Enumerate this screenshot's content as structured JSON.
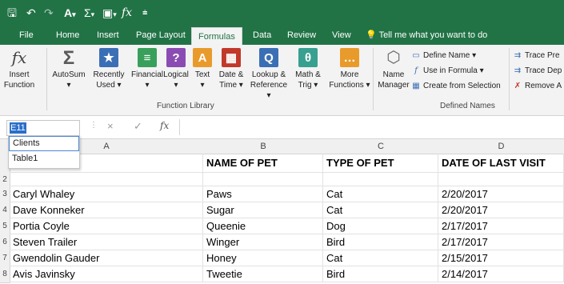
{
  "qat": {
    "icons": [
      "save-icon",
      "undo-icon",
      "redo-icon",
      "font-color-icon",
      "autosum-icon",
      "insert-shape-icon",
      "fx-icon",
      "customize-icon"
    ]
  },
  "tabs": [
    {
      "label": "File"
    },
    {
      "label": "Home"
    },
    {
      "label": "Insert"
    },
    {
      "label": "Page Layout"
    },
    {
      "label": "Formulas"
    },
    {
      "label": "Data"
    },
    {
      "label": "Review"
    },
    {
      "label": "View"
    }
  ],
  "tellme": "Tell me what you want to do",
  "ribbon": {
    "insert_function": {
      "line1": "Insert",
      "line2": "Function"
    },
    "function_library": [
      {
        "line1": "AutoSum",
        "line2": "▾",
        "color": "#5a5a5a",
        "glyph": "Σ"
      },
      {
        "line1": "Recently",
        "line2": "Used ▾",
        "color": "#3b6fb5",
        "glyph": "★"
      },
      {
        "line1": "Financial",
        "line2": "▾",
        "color": "#38a05a",
        "glyph": "≡"
      },
      {
        "line1": "Logical",
        "line2": "▾",
        "color": "#8a4cb3",
        "glyph": "?"
      },
      {
        "line1": "Text",
        "line2": "▾",
        "color": "#e89b2b",
        "glyph": "A"
      },
      {
        "line1": "Date &",
        "line2": "Time ▾",
        "color": "#c0392b",
        "glyph": "▦"
      },
      {
        "line1": "Lookup &",
        "line2": "Reference ▾",
        "color": "#3b6fb5",
        "glyph": "Q"
      },
      {
        "line1": "Math &",
        "line2": "Trig ▾",
        "color": "#38a090",
        "glyph": "θ"
      },
      {
        "line1": "More",
        "line2": "Functions ▾",
        "color": "#e89b2b",
        "glyph": "…"
      }
    ],
    "function_library_label": "Function Library",
    "name_manager": {
      "line1": "Name",
      "line2": "Manager"
    },
    "defined_names": {
      "define_name": "Define Name ▾",
      "use_in_formula": "Use in Formula ▾",
      "create_from_selection": "Create from Selection",
      "label": "Defined Names"
    },
    "formula_auditing": {
      "trace_precedents": "Trace Pre",
      "trace_dependents": "Trace Dep",
      "remove_arrows": "Remove A"
    }
  },
  "formula_bar": {
    "name_box": "E11",
    "cancel": "×",
    "enter": "✓",
    "fx": "fx",
    "formula": ""
  },
  "name_dropdown": [
    "Clients",
    "Table1"
  ],
  "grid": {
    "columns": [
      "A",
      "B",
      "C",
      "D"
    ],
    "headers": [
      "",
      "NAME OF PET",
      "TYPE OF PET",
      "DATE OF LAST VISIT"
    ],
    "rows": [
      {
        "num": "2",
        "cells": [
          "",
          "",
          "",
          ""
        ]
      },
      {
        "num": "3",
        "cells": [
          "Caryl Whaley",
          "Paws",
          "Cat",
          "2/20/2017"
        ]
      },
      {
        "num": "4",
        "cells": [
          "Dave Konneker",
          "Sugar",
          "Cat",
          "2/20/2017"
        ]
      },
      {
        "num": "5",
        "cells": [
          "Portia Coyle",
          "Queenie",
          "Dog",
          "2/17/2017"
        ]
      },
      {
        "num": "6",
        "cells": [
          "Steven Trailer",
          "Winger",
          "Bird",
          "2/17/2017"
        ]
      },
      {
        "num": "7",
        "cells": [
          "Gwendolin Gauder",
          "Honey",
          "Cat",
          "2/15/2017"
        ]
      },
      {
        "num": "8",
        "cells": [
          "Avis Javinsky",
          "Tweetie",
          "Bird",
          "2/14/2017"
        ]
      }
    ]
  },
  "colors": {
    "brand": "#217346",
    "ribbon_bg": "#f3f3f3",
    "selection": "#2a6fc9"
  }
}
